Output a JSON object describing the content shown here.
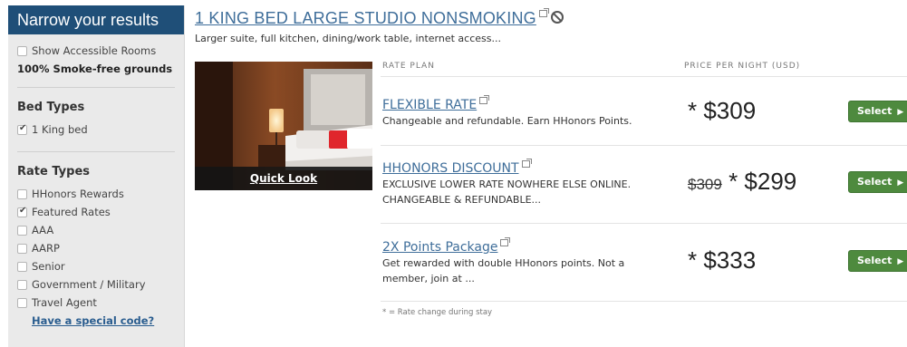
{
  "sidebar": {
    "header": "Narrow your results",
    "accessible_label": "Show Accessible Rooms",
    "smoke_free": "100% Smoke-free grounds",
    "bed_types": {
      "title": "Bed Types",
      "options": [
        {
          "label": "1 King bed",
          "checked": true
        }
      ]
    },
    "rate_types": {
      "title": "Rate Types",
      "options": [
        {
          "label": "HHonors Rewards",
          "checked": false
        },
        {
          "label": "Featured Rates",
          "checked": true
        },
        {
          "label": "AAA",
          "checked": false
        },
        {
          "label": "AARP",
          "checked": false
        },
        {
          "label": "Senior",
          "checked": false
        },
        {
          "label": "Government / Military",
          "checked": false
        },
        {
          "label": "Travel Agent",
          "checked": false
        }
      ]
    },
    "special_code": "Have a special code?"
  },
  "room": {
    "title": "1 KING BED LARGE STUDIO NONSMOKING",
    "description": "Larger suite, full kitchen, dining/work table, internet access...",
    "quick_look": "Quick Look"
  },
  "table": {
    "col_rate": "RATE PLAN",
    "col_price": "PRICE PER NIGHT (USD)",
    "rates": [
      {
        "name": "FLEXIBLE RATE",
        "desc_lines": [
          "Changeable and refundable. Earn HHonors Points."
        ],
        "old_price": "",
        "price": "* $309",
        "select": "Select"
      },
      {
        "name": "HHONORS DISCOUNT",
        "desc_lines": [
          "EXCLUSIVE LOWER RATE NOWHERE ELSE ONLINE.",
          "CHANGEABLE & REFUNDABLE..."
        ],
        "old_price": "$309",
        "price": "* $299",
        "select": "Select"
      },
      {
        "name": "2X Points Package",
        "desc_lines": [
          "Get rewarded with double HHonors points. Not a",
          "member, join at ..."
        ],
        "old_price": "",
        "price": "* $333",
        "select": "Select"
      }
    ],
    "footnote": "* = Rate change during stay"
  },
  "colors": {
    "sidebar_header": "#1f4f78",
    "link": "#3f6e9a",
    "select_button": "#4e8a3e"
  }
}
